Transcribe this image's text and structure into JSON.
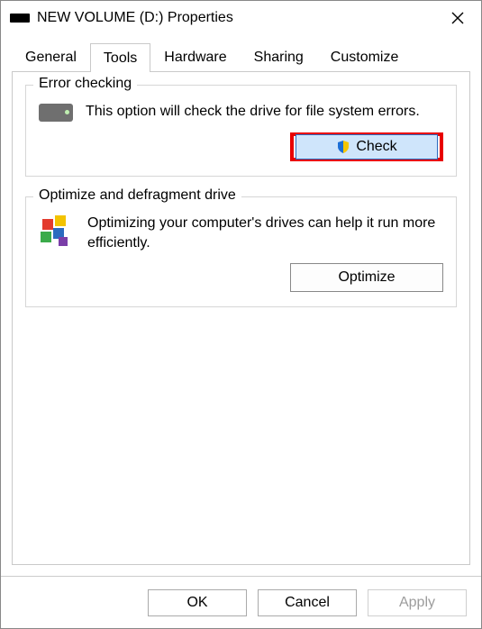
{
  "window": {
    "title": "NEW VOLUME (D:) Properties"
  },
  "tabs": {
    "general": "General",
    "tools": "Tools",
    "hardware": "Hardware",
    "sharing": "Sharing",
    "customize": "Customize"
  },
  "error_check": {
    "group_title": "Error checking",
    "description": "This option will check the drive for file system errors.",
    "button": "Check"
  },
  "optimize": {
    "group_title": "Optimize and defragment drive",
    "description": "Optimizing your computer's drives can help it run more efficiently.",
    "button": "Optimize"
  },
  "footer": {
    "ok": "OK",
    "cancel": "Cancel",
    "apply": "Apply"
  }
}
